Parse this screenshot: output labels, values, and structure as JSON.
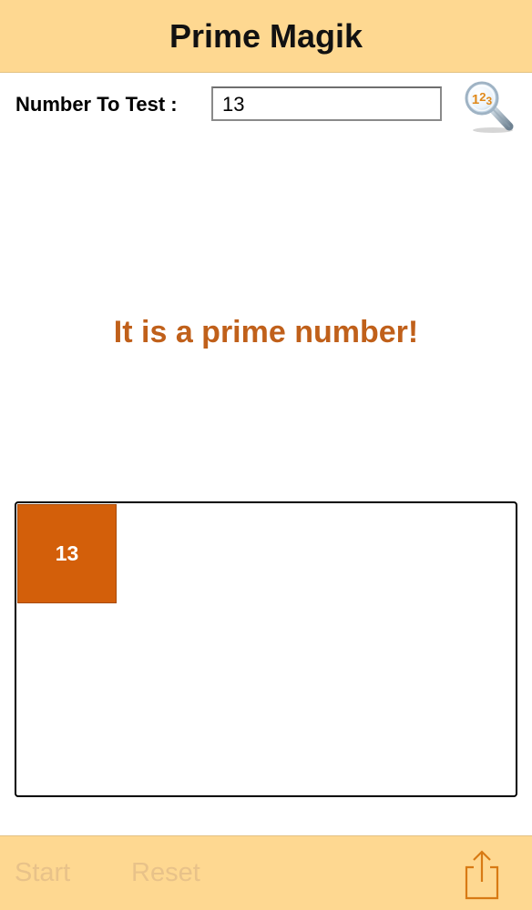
{
  "app": {
    "title": "Prime Magik"
  },
  "input": {
    "label": "Number To Test :",
    "value": "13"
  },
  "result": {
    "message": "It is a prime number!"
  },
  "factors": {
    "tiles": [
      "13"
    ]
  },
  "toolbar": {
    "start_label": "Start",
    "reset_label": "Reset"
  },
  "icons": {
    "search": "magnifier-123-icon",
    "share": "share-icon"
  },
  "colors": {
    "bar": "#fed891",
    "accent": "#d35f0a",
    "result_text": "#c0601a",
    "disabled": "#e8c289"
  }
}
